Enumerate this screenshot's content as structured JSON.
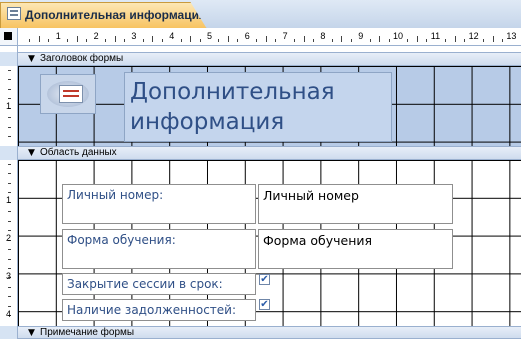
{
  "tab": {
    "title": "Дополнительная информация",
    "icon": "form-icon"
  },
  "ruler": {
    "horizontal_numbers": [
      "1",
      "2",
      "3",
      "4",
      "5",
      "6",
      "7",
      "8",
      "9",
      "10",
      "11",
      "12",
      "13"
    ],
    "vertical_header_numbers": [
      "1"
    ],
    "vertical_detail_numbers": [
      "1",
      "2",
      "3",
      "4"
    ]
  },
  "sections": {
    "header": "Заголовок формы",
    "detail": "Область данных",
    "footer": "Примечание формы"
  },
  "header": {
    "title": "Дополнительная информация",
    "logo_icon": "form-logo-icon"
  },
  "detail": {
    "labels": {
      "id": "Личный номер:",
      "study_form": "Форма обучения:",
      "session_closed": "Закрытие сессии в срок:",
      "debts": "Наличие задолженностей:"
    },
    "fields": {
      "id": "Личный номер",
      "study_form": "Форма обучения"
    },
    "checkboxes": {
      "session_closed": true,
      "debts": true
    }
  },
  "colors": {
    "header_bg": "#b7cbe7",
    "tab_bg": "#f7c25f",
    "label_text": "#2f4f86"
  }
}
